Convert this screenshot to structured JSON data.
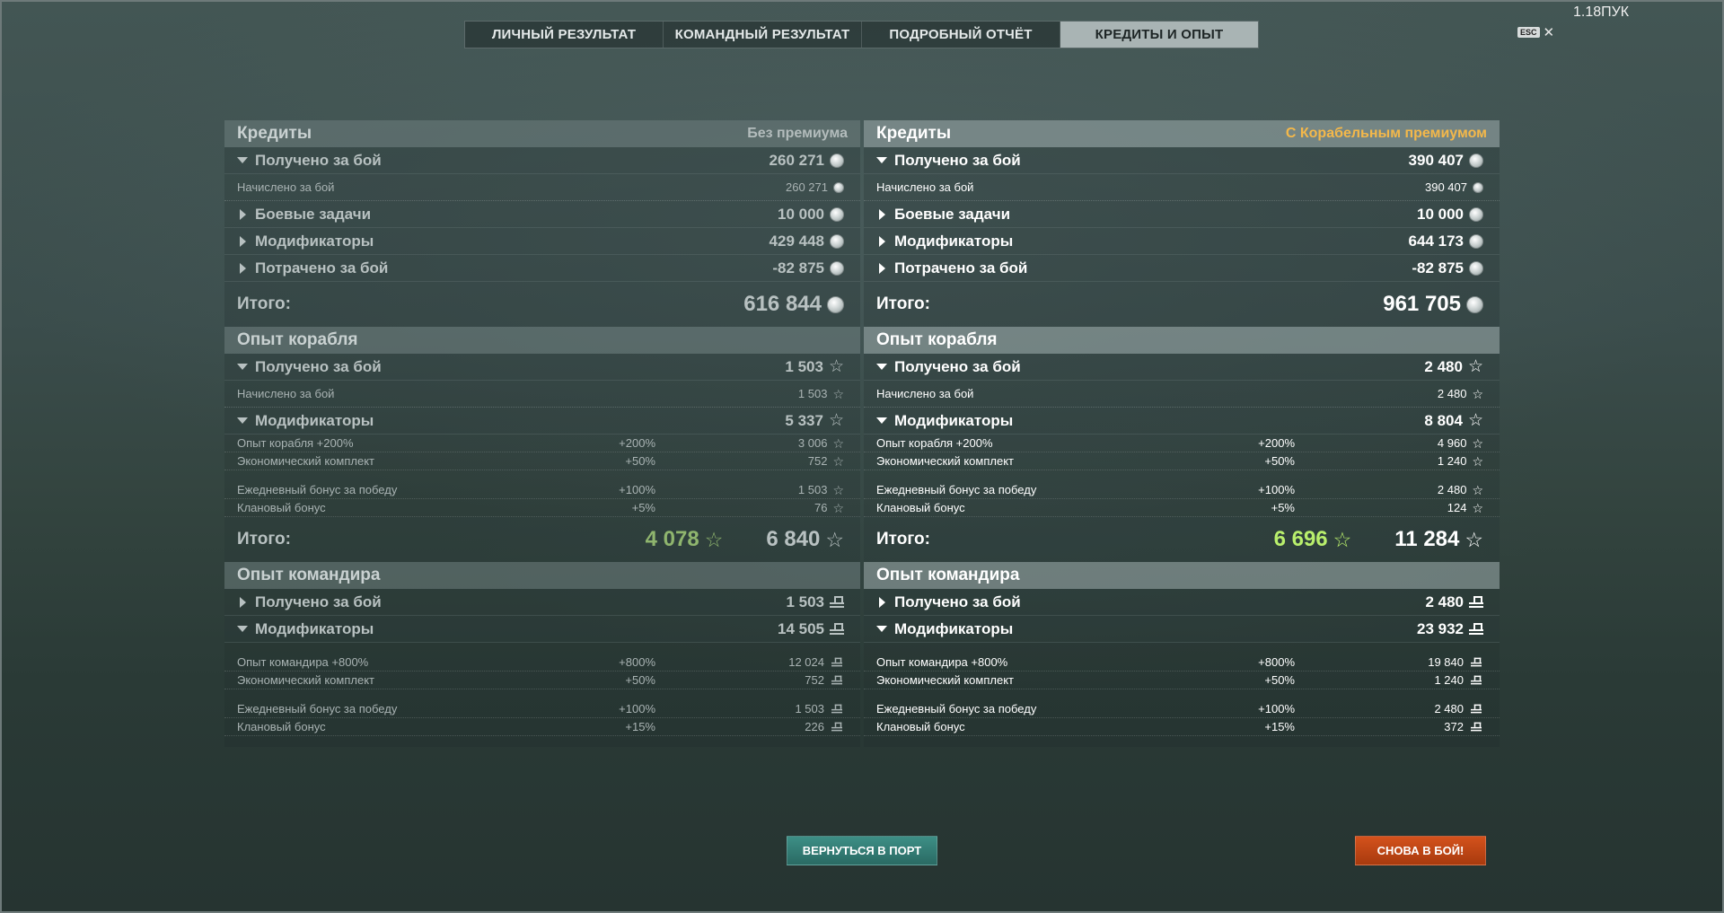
{
  "tabs": [
    "ЛИЧНЫЙ РЕЗУЛЬТАТ",
    "КОМАНДНЫЙ РЕЗУЛЬТАТ",
    "ПОДРОБНЫЙ ОТЧЁТ",
    "КРЕДИТЫ И ОПЫТ"
  ],
  "active_tab": "КРЕДИТЫ И ОПЫТ",
  "version": "1.18ПУК",
  "esc_label": "ESC",
  "close_glyph": "✕",
  "icons": {
    "credits": "silver-coin-icon",
    "xp": "star-icon",
    "commander_xp": "commander-cap-icon"
  },
  "colors": {
    "premium_label": "#f4b84a",
    "total_green_left": "#8fb56e",
    "total_green_right": "#b9ef6c",
    "port_button": "#2f7a72",
    "battle_button": "#c04814"
  },
  "left": {
    "credits": {
      "title": "Кредиты",
      "subtitle": "Без премиума",
      "received": {
        "label": "Получено за бой",
        "value": "260 271"
      },
      "accrued": {
        "label": "Начислено за бой",
        "value": "260 271"
      },
      "missions": {
        "label": "Боевые задачи",
        "value": "10 000"
      },
      "modifiers": {
        "label": "Модификаторы",
        "value": "429 448"
      },
      "spent": {
        "label": "Потрачено за бой",
        "value": "-82 875"
      },
      "total": {
        "label": "Итого:",
        "value": "616 844"
      }
    },
    "ship_xp": {
      "title": "Опыт корабля",
      "received": {
        "label": "Получено за бой",
        "value": "1 503"
      },
      "accrued": {
        "label": "Начислено за бой",
        "value": "1 503"
      },
      "modifiers": {
        "label": "Модификаторы",
        "value": "5 337"
      },
      "items": [
        {
          "label": "Опыт корабля +200%",
          "pct": "+200%",
          "value": "3 006"
        },
        {
          "label": "Экономический комплект",
          "pct": "+50%",
          "value": "752"
        },
        {
          "label": "Ежедневный бонус за победу",
          "pct": "+100%",
          "value": "1 503"
        },
        {
          "label": "Клановый бонус",
          "pct": "+5%",
          "value": "76"
        }
      ],
      "total": {
        "label": "Итого:",
        "free": "4 078",
        "value": "6 840"
      }
    },
    "cmdr_xp": {
      "title": "Опыт командира",
      "received": {
        "label": "Получено за бой",
        "value": "1 503"
      },
      "modifiers": {
        "label": "Модификаторы",
        "value": "14 505"
      },
      "items": [
        {
          "label": "Опыт командира +800%",
          "pct": "+800%",
          "value": "12 024"
        },
        {
          "label": "Экономический комплект",
          "pct": "+50%",
          "value": "752"
        },
        {
          "label": "Ежедневный бонус за победу",
          "pct": "+100%",
          "value": "1 503"
        },
        {
          "label": "Клановый бонус",
          "pct": "+15%",
          "value": "226"
        }
      ]
    }
  },
  "right": {
    "credits": {
      "title": "Кредиты",
      "subtitle": "С Корабельным премиумом",
      "received": {
        "label": "Получено за бой",
        "value": "390 407"
      },
      "accrued": {
        "label": "Начислено за бой",
        "value": "390 407"
      },
      "missions": {
        "label": "Боевые задачи",
        "value": "10 000"
      },
      "modifiers": {
        "label": "Модификаторы",
        "value": "644 173"
      },
      "spent": {
        "label": "Потрачено за бой",
        "value": "-82 875"
      },
      "total": {
        "label": "Итого:",
        "value": "961 705"
      }
    },
    "ship_xp": {
      "title": "Опыт корабля",
      "received": {
        "label": "Получено за бой",
        "value": "2 480"
      },
      "accrued": {
        "label": "Начислено за бой",
        "value": "2 480"
      },
      "modifiers": {
        "label": "Модификаторы",
        "value": "8 804"
      },
      "items": [
        {
          "label": "Опыт корабля +200%",
          "pct": "+200%",
          "value": "4 960"
        },
        {
          "label": "Экономический комплект",
          "pct": "+50%",
          "value": "1 240"
        },
        {
          "label": "Ежедневный бонус за победу",
          "pct": "+100%",
          "value": "2 480"
        },
        {
          "label": "Клановый бонус",
          "pct": "+5%",
          "value": "124"
        }
      ],
      "total": {
        "label": "Итого:",
        "free": "6 696",
        "value": "11 284"
      }
    },
    "cmdr_xp": {
      "title": "Опыт командира",
      "received": {
        "label": "Получено за бой",
        "value": "2 480"
      },
      "modifiers": {
        "label": "Модификаторы",
        "value": "23 932"
      },
      "items": [
        {
          "label": "Опыт командира +800%",
          "pct": "+800%",
          "value": "19 840"
        },
        {
          "label": "Экономический комплект",
          "pct": "+50%",
          "value": "1 240"
        },
        {
          "label": "Ежедневный бонус за победу",
          "pct": "+100%",
          "value": "2 480"
        },
        {
          "label": "Клановый бонус",
          "pct": "+15%",
          "value": "372"
        }
      ]
    }
  },
  "buttons": {
    "port": "ВЕРНУТЬСЯ В ПОРТ",
    "battle": "СНОВА В БОЙ!"
  }
}
